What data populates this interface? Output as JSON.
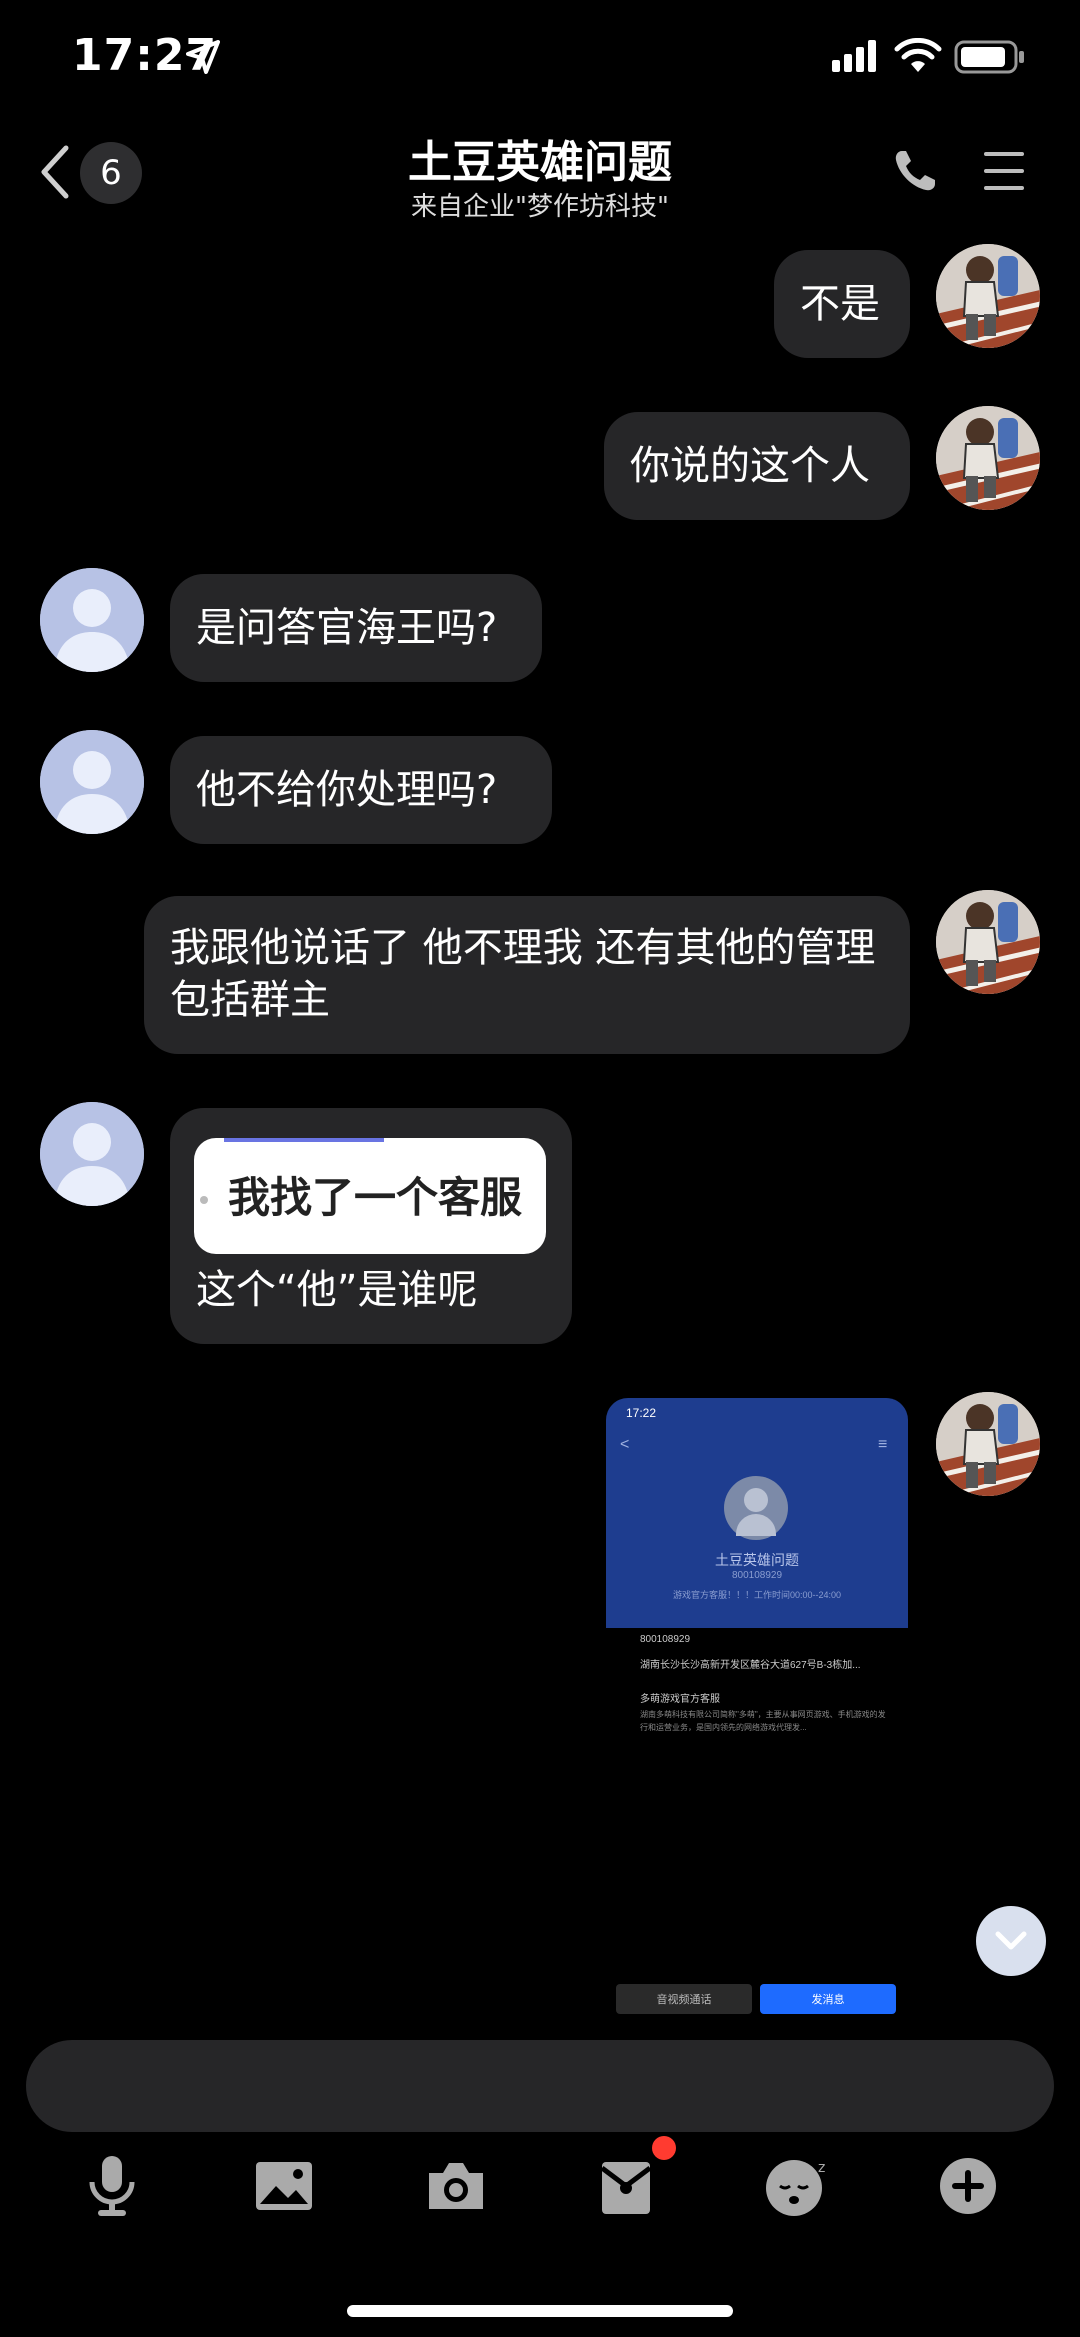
{
  "status_bar": {
    "time": "17:27"
  },
  "header": {
    "unread_count": "6",
    "title": "土豆英雄问题",
    "subtitle": "来自企业\"梦作坊科技\""
  },
  "messages": [
    {
      "side": "right",
      "text": "不是"
    },
    {
      "side": "right",
      "text": "你说的这个人"
    },
    {
      "side": "left",
      "text": "是问答官海王吗?"
    },
    {
      "side": "left",
      "text": "他不给你处理吗?"
    },
    {
      "side": "right",
      "text": "我跟他说话了 他不理我  还有其他的管理包括群主"
    },
    {
      "side": "left",
      "quote": "我找了一个客服",
      "text": "这个“他”是谁呢"
    }
  ],
  "screenshot_message": {
    "time": "17:22",
    "name": "土豆英雄问题",
    "id": "800108929",
    "desc": "游戏官方客服！！！工作时间00:00--24:00",
    "row_id": "800108929",
    "row_address": "湖南长沙长沙高新开发区麓谷大道627号B-3栋加...",
    "company": "多萌游戏官方客服",
    "company_desc": "湖南多萌科技有限公司简称\"多萌\"，主要从事网页游戏、手机游戏的发行和运营业务，是国内领先的网络游戏代理发...",
    "btn_call": "音视频通话",
    "btn_message": "发消息"
  },
  "toolbar": [
    "mic-icon",
    "image-icon",
    "camera-icon",
    "red-packet-icon",
    "emoji-icon",
    "plus-icon"
  ],
  "colors": {
    "bubble": "#262628",
    "accent": "#1e6bff",
    "badge": "#ff3b30",
    "card_blue": "#1e3d8f"
  }
}
